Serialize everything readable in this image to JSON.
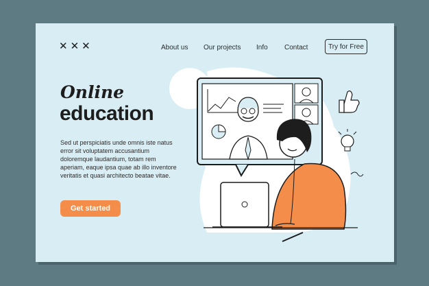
{
  "brand": {
    "logo_text": "✕✕✕"
  },
  "nav": {
    "items": [
      "About us",
      "Our projects",
      "Info",
      "Contact"
    ],
    "cta": "Try for Free"
  },
  "hero": {
    "title_line1": "Online",
    "title_line2": "education",
    "description": "Sed ut perspiciatis unde omnis iste natus error sit voluptatem accusantium doloremque laudantium, totam rem aperiam, eaque ipsa quae ab illo inventore veritatis et quasi architecto beatae vitae.",
    "button": "Get started"
  },
  "colors": {
    "background": "#5e7a82",
    "card": "#d8eef4",
    "accent": "#f58d4a",
    "ink": "#1d1d1d"
  }
}
